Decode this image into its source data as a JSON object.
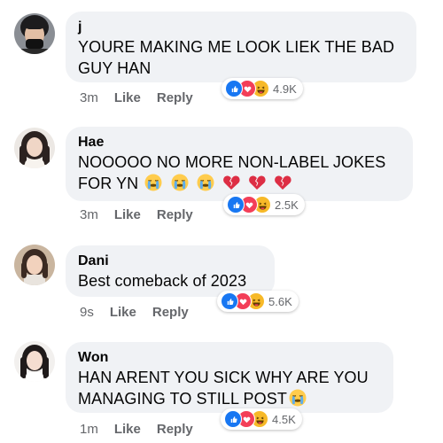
{
  "comments": [
    {
      "name": "j",
      "text_lines": [
        "YOURE MAKING ME LOOK LIEK THE BAD",
        "GUY HAN"
      ],
      "time": "3m",
      "like_label": "Like",
      "reply_label": "Reply",
      "reaction_count": "4.9K"
    },
    {
      "name": "Hae",
      "text_lines": [
        "NOOOOO NO MORE NON-LABEL JOKES",
        "FOR YN"
      ],
      "time": "3m",
      "like_label": "Like",
      "reply_label": "Reply",
      "reaction_count": "2.5K"
    },
    {
      "name": "Dani",
      "text_lines": [
        "Best comeback of 2023"
      ],
      "time": "9s",
      "like_label": "Like",
      "reply_label": "Reply",
      "reaction_count": "5.6K"
    },
    {
      "name": "Won",
      "text_lines": [
        "HAN ARENT YOU SICK WHY ARE YOU",
        "MANAGING TO STILL POST"
      ],
      "time": "1m",
      "like_label": "Like",
      "reply_label": "Reply",
      "reaction_count": "4.5K"
    }
  ],
  "icons": {
    "like": "like-reaction-icon",
    "love": "love-reaction-icon",
    "haha": "haha-reaction-icon",
    "crying": "loudly-crying-emoji",
    "broken_heart": "broken-heart-emoji"
  },
  "colors": {
    "bubble": "#f0f2f5",
    "meta_text": "#65676b",
    "like_blue": "#1877f2",
    "love_red": "#f33e58",
    "haha_yellow": "#f7b928"
  }
}
